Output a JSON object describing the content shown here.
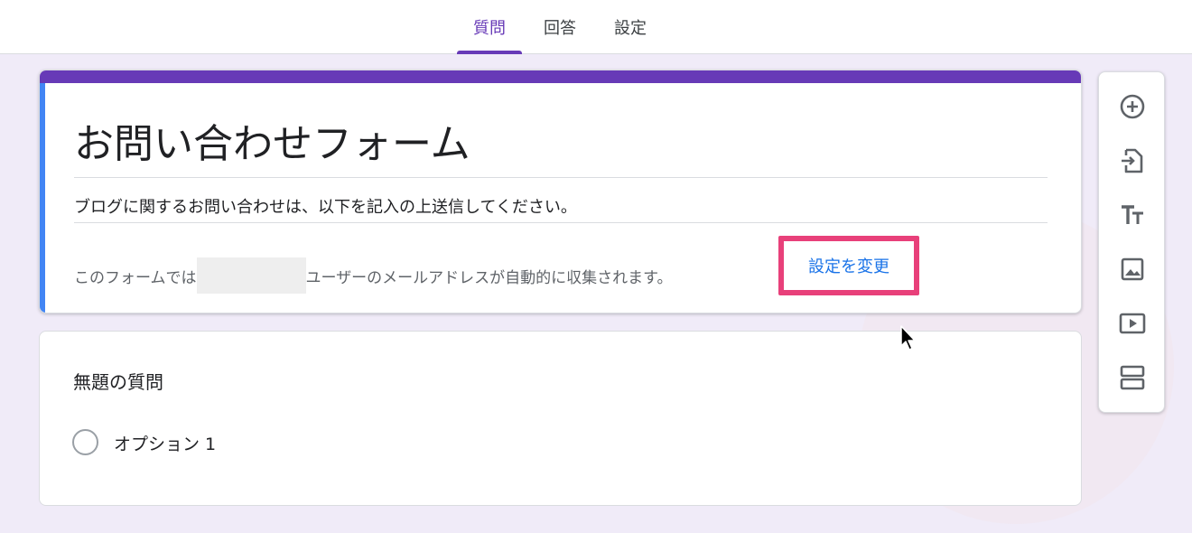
{
  "tabs": [
    {
      "label": "質問",
      "active": true
    },
    {
      "label": "回答",
      "active": false
    },
    {
      "label": "設定",
      "active": false
    }
  ],
  "form": {
    "title": "お問い合わせフォーム",
    "description": "ブログに関するお問い合わせは、以下を記入の上送信してください。",
    "collect_prefix": "このフォームでは",
    "collect_suffix": "ユーザーのメールアドレスが自動的に収集されます。",
    "change_settings_link": "設定を変更"
  },
  "question": {
    "title": "無題の質問",
    "options": [
      "オプション 1"
    ]
  },
  "toolbar": {
    "icons": [
      "add-question-icon",
      "import-questions-icon",
      "add-title-icon",
      "add-image-icon",
      "add-video-icon",
      "add-section-icon"
    ]
  },
  "colors": {
    "accent": "#673ab7",
    "active_card": "#4285f4",
    "link": "#1a73e8",
    "highlight": "#e8407a",
    "background": "#f0ebf8"
  }
}
